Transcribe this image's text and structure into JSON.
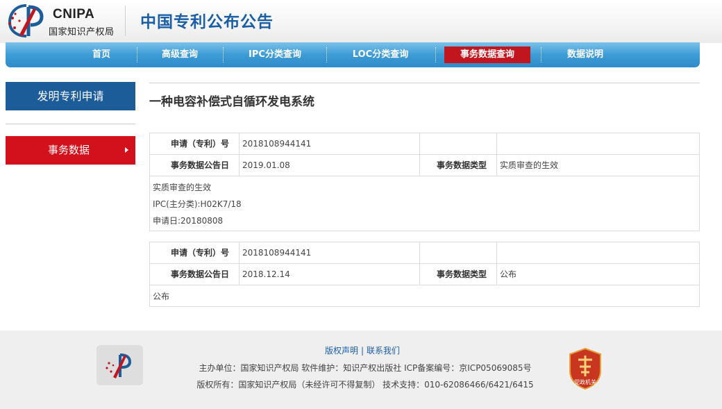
{
  "header": {
    "logo_text_en": "CNIPA",
    "logo_text_cn": "国家知识产权局",
    "site_title": "中国专利公布公告"
  },
  "nav": {
    "items": [
      {
        "label": "首页"
      },
      {
        "label": "高级查询"
      },
      {
        "label": "IPC分类查询"
      },
      {
        "label": "LOC分类查询"
      },
      {
        "label": "事务数据查询",
        "active": true
      },
      {
        "label": "数据说明"
      }
    ]
  },
  "sidebar": {
    "title": "发明专利申请",
    "item": "事务数据"
  },
  "main": {
    "title": "一种电容补偿式自循环发电系统",
    "records": [
      {
        "label_app_no": "申请（专利）号",
        "app_no": "2018108944141",
        "label_date": "事务数据公告日",
        "date": "2019.01.08",
        "label_type": "事务数据类型",
        "type": "实质审查的生效",
        "details": [
          "实质审查的生效",
          "IPC(主分类):H02K7/18",
          "申请日:20180808"
        ]
      },
      {
        "label_app_no": "申请（专利）号",
        "app_no": "2018108944141",
        "label_date": "事务数据公告日",
        "date": "2018.12.14",
        "label_type": "事务数据类型",
        "type": "公布",
        "details": [
          "公布"
        ]
      }
    ]
  },
  "footer": {
    "link_copyright": "版权声明",
    "separator": "|",
    "link_contact": "联系我们",
    "line1": "主办单位：国家知识产权局   软件维护：知识产权出版社   ICP备案编号：京ICP05069085号",
    "line2": "版权所有：国家知识产权局（未经许可不得复制）   技术支持：010-62086466/6421/6415",
    "badge_text": "党政机关",
    "colors": {
      "brand_red": "#d3111c",
      "brand_blue": "#1c5c99",
      "nav_blue": "#3d9bd5"
    }
  }
}
